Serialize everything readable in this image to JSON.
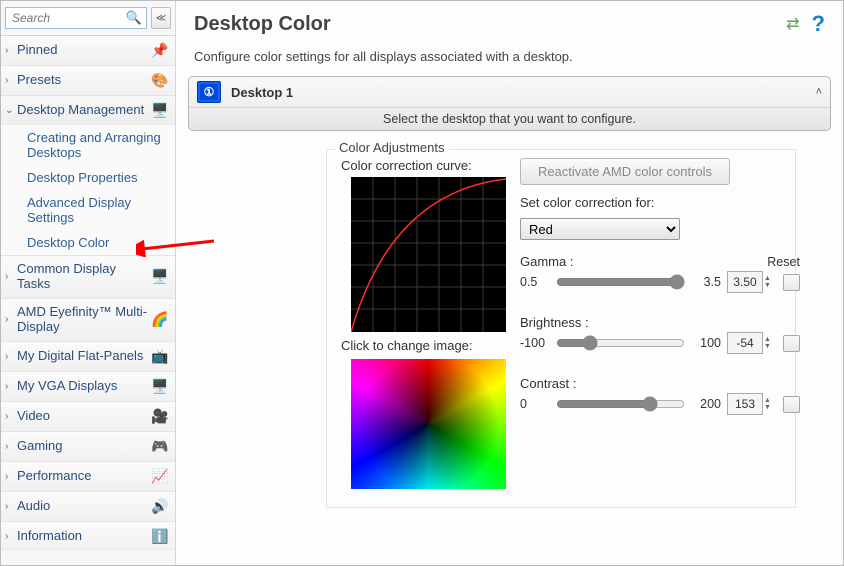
{
  "search": {
    "placeholder": "Search"
  },
  "sidebar": {
    "pinned": {
      "label": "Pinned",
      "icon": "📌"
    },
    "presets": {
      "label": "Presets",
      "icon": "🎨"
    },
    "desktopMgmt": {
      "label": "Desktop Management",
      "icon": "🖥️",
      "sub": {
        "s0": "Creating and Arranging Desktops",
        "s1": "Desktop Properties",
        "s2": "Advanced Display Settings",
        "s3": "Desktop Color"
      }
    },
    "common": {
      "label": "Common Display Tasks",
      "icon": "🖥️"
    },
    "eyefinity": {
      "label": "AMD Eyefinity™ Multi-Display",
      "icon": "🌈"
    },
    "flat": {
      "label": "My Digital Flat-Panels",
      "icon": "📺"
    },
    "vga": {
      "label": "My VGA Displays",
      "icon": "🖥️"
    },
    "video": {
      "label": "Video",
      "icon": "🎥"
    },
    "gaming": {
      "label": "Gaming",
      "icon": "🎮"
    },
    "perf": {
      "label": "Performance",
      "icon": "📈"
    },
    "audio": {
      "label": "Audio",
      "icon": "🔊"
    },
    "info": {
      "label": "Information",
      "icon": "ℹ️"
    }
  },
  "page": {
    "title": "Desktop Color",
    "subtitle": "Configure color settings for all displays associated with a desktop.",
    "display": {
      "badge": "①",
      "name": "Desktop 1",
      "hint": "Select the desktop that you want to configure."
    }
  },
  "panel": {
    "title": "Color Adjustments",
    "curveLabel": "Color correction curve:",
    "clickLabel": "Click to change image:",
    "reactivate": "Reactivate AMD color controls",
    "setFor": "Set color correction for:",
    "channel": "Red",
    "resetHeader": "Reset",
    "gamma": {
      "label": "Gamma :",
      "min": "0.5",
      "max": "3.5",
      "value": "3.50",
      "slider": 100
    },
    "brightness": {
      "label": "Brightness :",
      "min": "-100",
      "max": "100",
      "value": "-54",
      "slider": 23
    },
    "contrast": {
      "label": "Contrast :",
      "min": "0",
      "max": "200",
      "value": "153",
      "slider": 76
    }
  }
}
